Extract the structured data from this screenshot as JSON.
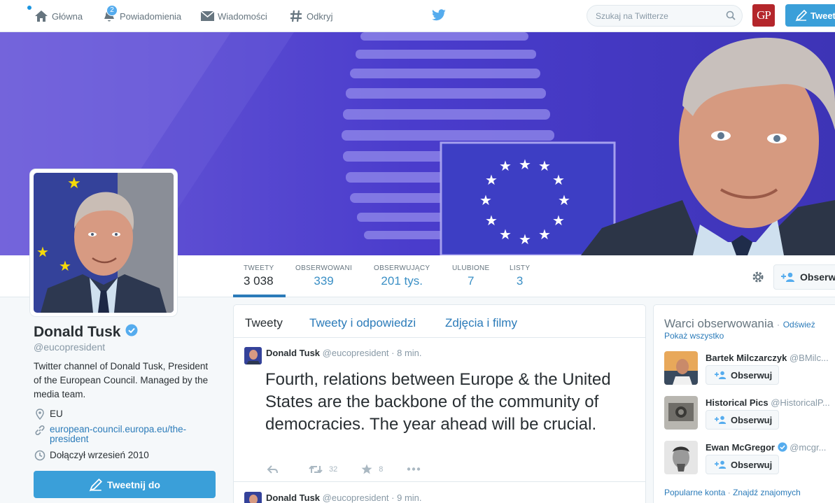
{
  "nav": {
    "home": "Główna",
    "notifications": "Powiadomienia",
    "notifications_badge": "2",
    "messages": "Wiadomości",
    "discover": "Odkryj",
    "search_placeholder": "Szukaj na Twitterze",
    "tweet_button": "Tweet",
    "gp_logo": "GP"
  },
  "stats": [
    {
      "label": "TWEETY",
      "value": "3 038"
    },
    {
      "label": "OBSERWOWANI",
      "value": "339"
    },
    {
      "label": "OBSERWUJĄCY",
      "value": "201 tys."
    },
    {
      "label": "ULUBIONE",
      "value": "7"
    },
    {
      "label": "LISTY",
      "value": "3"
    }
  ],
  "follow_button": "Obserwuj",
  "profile": {
    "name": "Donald Tusk",
    "handle": "@eucopresident",
    "bio": "Twitter channel of Donald Tusk, President of the European Council. Managed by the media team.",
    "location": "EU",
    "url_line1": "european-council.europa.eu/the-",
    "url_line2": "president",
    "joined": "Dołączył wrzesień 2010",
    "tweet_to": "Tweetnij do"
  },
  "timeline": {
    "tabs": [
      "Tweety",
      "Tweety i odpowiedzi",
      "Zdjęcia i filmy"
    ],
    "tweets": [
      {
        "name": "Donald Tusk",
        "handle": "@eucopresident",
        "time": "· 8 min.",
        "text": "Fourth, relations between Europe & the United States are the backbone of the community of democracies. The year ahead will be crucial.",
        "retweets": "32",
        "favorites": "8"
      },
      {
        "name": "Donald Tusk",
        "handle": "@eucopresident",
        "time": "· 9 min."
      }
    ]
  },
  "wtf": {
    "title": "Warci obserwowania",
    "separator": "·",
    "refresh": "Odśwież",
    "show_all": "Pokaż wszystko",
    "suggestions": [
      {
        "name": "Bartek Milczarczyk",
        "handle": "@BMilc...",
        "follow": "Obserwuj"
      },
      {
        "name": "Historical Pics",
        "handle": "@HistoricalP...",
        "follow": "Obserwuj"
      },
      {
        "name": "Ewan McGregor",
        "handle": "@mcgr...",
        "follow": "Obserwuj"
      }
    ],
    "footer_popular": "Popularne konta",
    "footer_find": "Znajdź znajomych"
  },
  "colors": {
    "accent": "#2b7bb9",
    "tweet_button": "#3a9fd9",
    "banner_bg": "#5747c9",
    "eu_flag": "#3d3ec4",
    "eu_star": "#ffffff"
  }
}
